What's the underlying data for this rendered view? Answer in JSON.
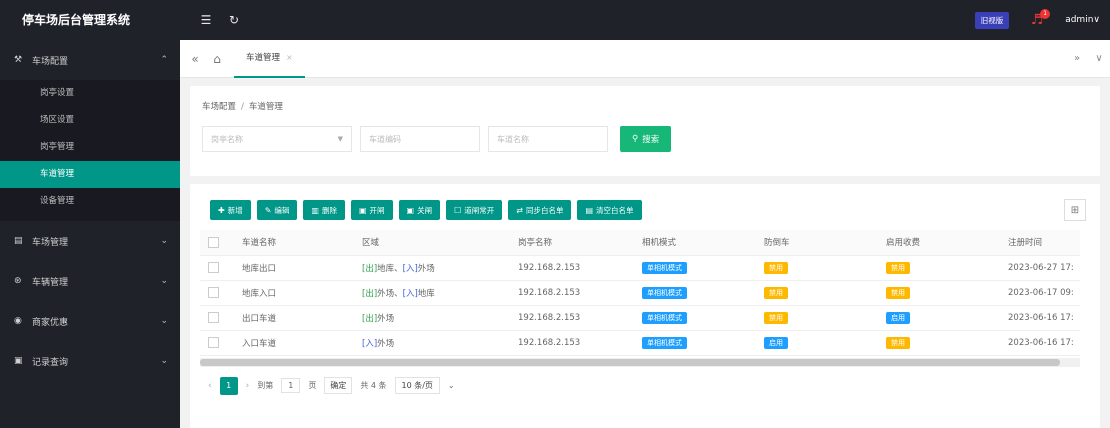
{
  "sidebar": {
    "brand": "停车场后台管理系统",
    "groups": [
      {
        "icon": "settings-icon",
        "glyph": "⚒",
        "label": "车场配置",
        "chevron": "⌃"
      },
      {
        "icon": "parking-icon",
        "glyph": "▤",
        "label": "车场管理",
        "chevron": "⌄"
      },
      {
        "icon": "vehicle-icon",
        "glyph": "⊛",
        "label": "车辆管理",
        "chevron": "⌄"
      },
      {
        "icon": "discount-icon",
        "glyph": "◉",
        "label": "商家优惠",
        "chevron": "⌄"
      },
      {
        "icon": "records-icon",
        "glyph": "▣",
        "label": "记录查询",
        "chevron": "⌄"
      }
    ],
    "sub_items": [
      "岗亭设置",
      "场区设置",
      "岗亭管理",
      "车道管理",
      "设备管理"
    ],
    "active_sub": "车道管理"
  },
  "topbar": {
    "menu_glyph": "☰",
    "refresh_glyph": "↻",
    "badge_label": "旧视版",
    "bell_count": "1",
    "user": "admin∨"
  },
  "tabs": {
    "prev_glyph": "«",
    "home_glyph": "⌂",
    "active_tab": "车道管理",
    "close_glyph": "×",
    "next_glyph": "»",
    "menu_glyph": "∨"
  },
  "breadcrumb": {
    "parent": "车场配置",
    "sep": "/",
    "current": "车道管理"
  },
  "filters": {
    "select_placeholder": "岗亭名称",
    "code_placeholder": "车道编码",
    "name_placeholder": "车道名称",
    "search_label": "搜索"
  },
  "toolbar": {
    "buttons": [
      {
        "glyph": "✚",
        "label": "新增",
        "name": "add-button"
      },
      {
        "glyph": "✎",
        "label": "编辑",
        "name": "edit-button"
      },
      {
        "glyph": "▥",
        "label": "删除",
        "name": "delete-button"
      },
      {
        "glyph": "▣",
        "label": "开闸",
        "name": "open-gate-button"
      },
      {
        "glyph": "▣",
        "label": "关闸",
        "name": "close-gate-button"
      },
      {
        "glyph": "☐",
        "label": "道闸常开",
        "name": "gate-always-open-button"
      },
      {
        "glyph": "⇄",
        "label": "同步白名单",
        "name": "sync-whitelist-button"
      },
      {
        "glyph": "▤",
        "label": "清空白名单",
        "name": "clear-whitelist-button"
      }
    ],
    "grid_glyph": "⊞"
  },
  "table": {
    "headers": [
      "车道名称",
      "区域",
      "岗亭名称",
      "相机模式",
      "防倒车",
      "启用收费",
      "注册时间"
    ],
    "rows": [
      {
        "name": "地库出口",
        "area": [
          [
            "[出]",
            "out"
          ],
          [
            "地库、",
            "plain"
          ],
          [
            "[入]",
            "in"
          ],
          [
            "外场",
            "plain"
          ]
        ],
        "booth": "192.168.2.153",
        "camera": "单相机模式",
        "anti_back": "禁用",
        "fee": "禁用",
        "time": "2023-06-27 17:"
      },
      {
        "name": "地库入口",
        "area": [
          [
            "[出]",
            "out"
          ],
          [
            "外场、",
            "plain"
          ],
          [
            "[入]",
            "in"
          ],
          [
            "地库",
            "plain"
          ]
        ],
        "booth": "192.168.2.153",
        "camera": "单相机模式",
        "anti_back": "禁用",
        "fee": "禁用",
        "time": "2023-06-17 09:"
      },
      {
        "name": "出口车道",
        "area": [
          [
            "[出]",
            "out"
          ],
          [
            "外场",
            "plain"
          ]
        ],
        "booth": "192.168.2.153",
        "camera": "单相机模式",
        "anti_back": "禁用",
        "fee": "启用",
        "time": "2023-06-16 17:"
      },
      {
        "name": "入口车道",
        "area": [
          [
            "[入]",
            "in"
          ],
          [
            "外场",
            "plain"
          ]
        ],
        "booth": "192.168.2.153",
        "camera": "单相机模式",
        "anti_back": "启用",
        "fee": "禁用",
        "time": "2023-06-16 17:"
      }
    ]
  },
  "pager": {
    "prev": "‹",
    "current": "1",
    "next": "›",
    "goto_label": "到第",
    "goto_value": "1",
    "page_unit": "页",
    "ok_label": "确定",
    "total": "共 4 条",
    "page_size": "10 条/页"
  },
  "colors": {
    "accent": "#009688",
    "search": "#16b777",
    "tag_blue": "#1e9fff",
    "tag_orange": "#ffb800",
    "out": "#2e9e4b",
    "in": "#3b5bdb"
  }
}
